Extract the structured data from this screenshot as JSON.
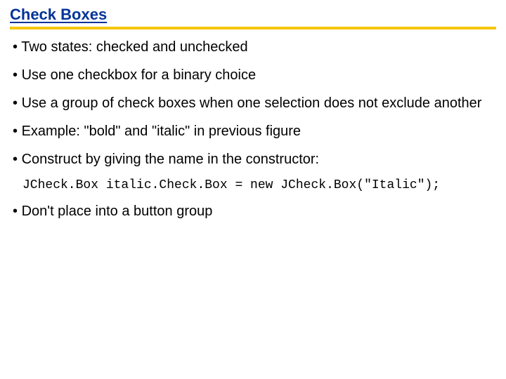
{
  "title": "Check Boxes",
  "bullets": [
    "Two states: checked and unchecked",
    "Use one checkbox for a binary choice",
    "Use a group of check boxes when one selection does not exclude another",
    "Example: \"bold\" and \"italic\" in previous figure",
    "Construct by giving the name in the constructor:"
  ],
  "code": "JCheck.Box italic.Check.Box = new JCheck.Box(\"Italic\");",
  "last_bullet": "Don't place into a button group"
}
